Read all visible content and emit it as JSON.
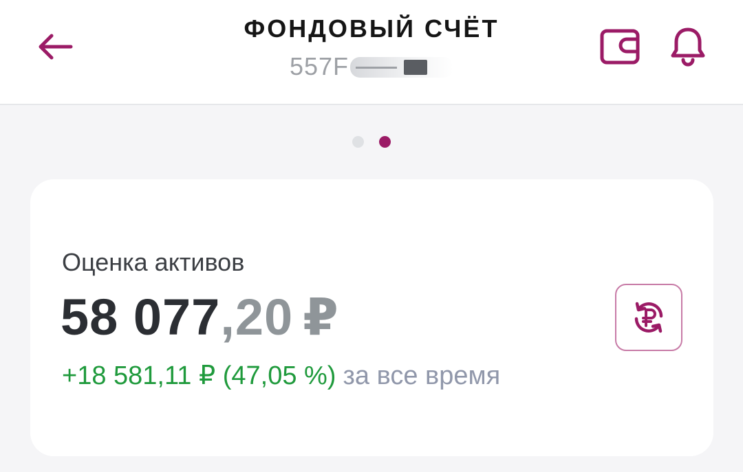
{
  "header": {
    "title": "ФОНДОВЫЙ СЧЁТ",
    "account_number_visible": "557F"
  },
  "icons": {
    "back": "arrow-left-icon",
    "wallet": "wallet-icon",
    "bell": "bell-icon",
    "refresh_ruble": "ruble-refresh-icon"
  },
  "pager": {
    "total": 2,
    "active_index": 1
  },
  "card": {
    "label": "Оценка активов",
    "amount_integer": "58 077",
    "amount_fraction": ",20",
    "currency": "₽",
    "change_value": "+18 581,11 ₽ (47,05 %)",
    "change_period": "за все время"
  },
  "colors": {
    "accent": "#9b1b66",
    "gain": "#1f9a3c",
    "muted": "#9097aa",
    "amount": "#2b2e33"
  }
}
